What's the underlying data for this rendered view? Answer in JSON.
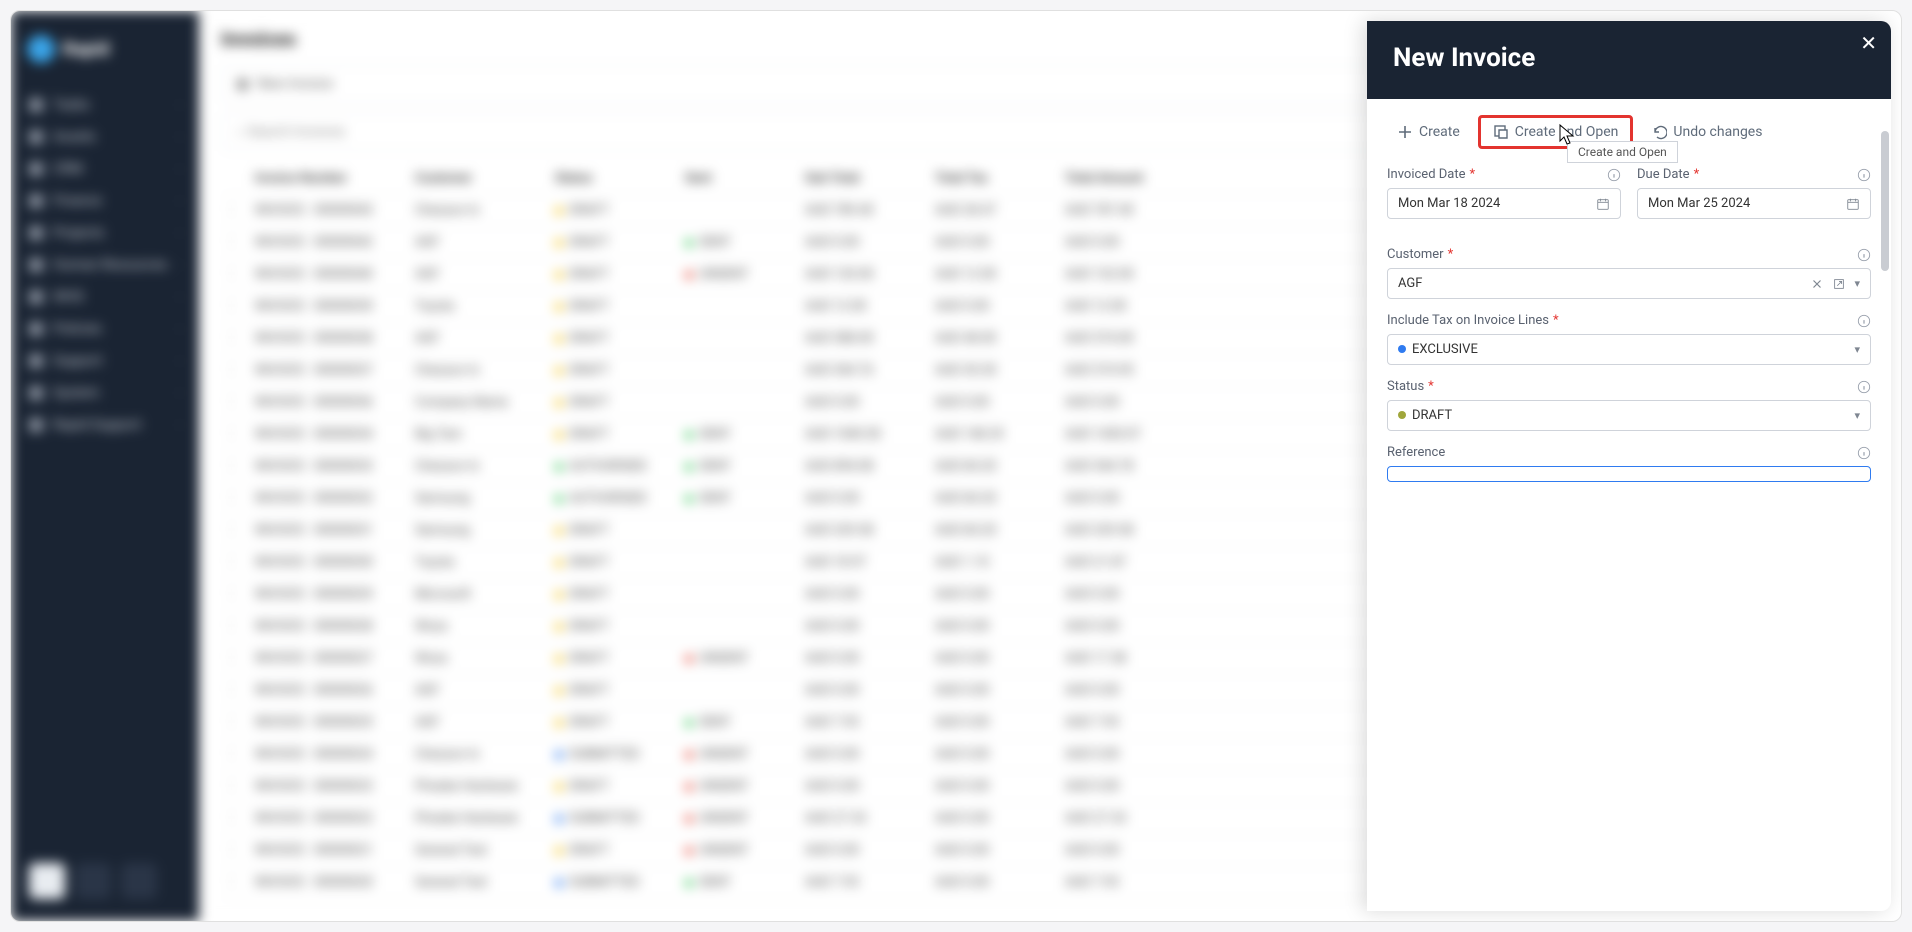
{
  "app": {
    "name": "Rapid"
  },
  "sidebar": {
    "items": [
      {
        "label": "Tasks"
      },
      {
        "label": "Assets"
      },
      {
        "label": "CRM"
      },
      {
        "label": "Finance"
      },
      {
        "label": "Projects"
      },
      {
        "label": "Human Resources"
      },
      {
        "label": "WHS"
      },
      {
        "label": "Policies"
      },
      {
        "label": "Support"
      },
      {
        "label": "System"
      },
      {
        "label": "Rapid Support"
      }
    ]
  },
  "page": {
    "title": "Invoices",
    "new_label": "New Invoice",
    "search_placeholder": "Search Invoices"
  },
  "table": {
    "headers": [
      "",
      "Invoice Number",
      "Customer",
      "Status",
      "Sent",
      "Sub Total",
      "Total Tax",
      "Total Amount"
    ],
    "rows": [
      {
        "num": "INVOICE - 00000043",
        "cust": "Chesson In",
        "status": "DRAFT",
        "sd": "y",
        "sent": "",
        "sub": "AUD 789.40",
        "tax": "AUD 28.47",
        "tot": "AUD 787.40"
      },
      {
        "num": "INVOICE - 00000042",
        "cust": "AGF",
        "status": "DRAFT",
        "sd": "y",
        "sent": "SENT",
        "sub": "AUD 0.00",
        "tax": "AUD 0.00",
        "tot": "AUD 0.00",
        "sentd": "g"
      },
      {
        "num": "INVOICE - 00000040",
        "cust": "AGF",
        "status": "DRAFT",
        "sd": "y",
        "sent": "UNSENT",
        "sub": "AUD 120.00",
        "tax": "AUD 12.00",
        "tot": "AUD 132.00",
        "sentd": "r"
      },
      {
        "num": "INVOICE - 00000039",
        "cust": "Toyota",
        "status": "DRAFT",
        "sd": "y",
        "sent": "",
        "sub": "AUD 12.00",
        "tax": "AUD 0.00",
        "tot": "AUD 12.00"
      },
      {
        "num": "INVOICE - 00000038",
        "cust": "AGF",
        "status": "DRAFT",
        "sd": "y",
        "sent": "",
        "sub": "AUD 588.00",
        "tax": "AUD 48.00",
        "tot": "AUD 574.00"
      },
      {
        "num": "INVOICE - 00000037",
        "cust": "Chesson In",
        "status": "DRAFT",
        "sd": "y",
        "sent": "",
        "sub": "AUD 304.76",
        "tax": "AUD 30.30",
        "tot": "AUD 374.95"
      },
      {
        "num": "INVOICE - 00000036",
        "cust": "Company Name",
        "status": "DRAFT",
        "sd": "y",
        "sent": "",
        "sub": "AUD 0.00",
        "tax": "AUD 0.00",
        "tot": "AUD 0.00"
      },
      {
        "num": "INVOICE - 00000034",
        "cust": "Big Tam",
        "status": "DRAFT",
        "sd": "y",
        "sent": "SENT",
        "sub": "AUD 1040.50",
        "tax": "AUD 148.29",
        "tot": "AUD 1430.07",
        "sentd": "g"
      },
      {
        "num": "INVOICE - 00000033",
        "cust": "Chesson In",
        "status": "AUTHORISED",
        "sd": "g",
        "sent": "SENT",
        "sub": "AUD 894.08",
        "tax": "AUD 84.20",
        "tot": "AUD 544.78",
        "sentd": "g"
      },
      {
        "num": "INVOICE - 00000032",
        "cust": "Samsung",
        "status": "AUTHORISED",
        "sd": "g",
        "sent": "SENT",
        "sub": "AUD 0.00",
        "tax": "AUD 84.20",
        "tot": "AUD 0.00",
        "sentd": "g"
      },
      {
        "num": "INVOICE - 00000031",
        "cust": "Samsung",
        "status": "DRAFT",
        "sd": "y",
        "sent": "",
        "sub": "AUD 329.58",
        "tax": "AUD 84.20",
        "tot": "AUD 329.58"
      },
      {
        "num": "INVOICE - 00000030",
        "cust": "Toyota",
        "status": "DRAFT",
        "sd": "y",
        "sent": "",
        "sub": "AUD 18.97",
        "tax": "AUD 1.10",
        "tot": "AUD 21.87"
      },
      {
        "num": "INVOICE - 00000029",
        "cust": "Microsoft",
        "status": "DRAFT",
        "sd": "y",
        "sent": "",
        "sub": "AUD 0.00",
        "tax": "AUD 0.00",
        "tot": "AUD 0.00"
      },
      {
        "num": "INVOICE - 00000028",
        "cust": "Woza",
        "status": "DRAFT",
        "sd": "y",
        "sent": "",
        "sub": "AUD 0.00",
        "tax": "AUD 0.00",
        "tot": "AUD 0.00"
      },
      {
        "num": "INVOICE - 00000027",
        "cust": "Woza",
        "status": "DRAFT",
        "sd": "y",
        "sent": "UNSENT",
        "sub": "AUD 0.00",
        "tax": "AUD 0.00",
        "tot": "AUD 17.38",
        "sentd": "r"
      },
      {
        "num": "INVOICE - 00000026",
        "cust": "AGF",
        "status": "DRAFT",
        "sd": "y",
        "sent": "",
        "sub": "AUD 0.00",
        "tax": "AUD 0.00",
        "tot": "AUD 0.00"
      },
      {
        "num": "INVOICE - 00000025",
        "cust": "AGF",
        "status": "DRAFT",
        "sd": "y",
        "sent": "SENT",
        "sub": "AUD 7.93",
        "tax": "AUD 0.00",
        "tot": "AUD 7.93",
        "sentd": "g"
      },
      {
        "num": "INVOICE - 00000024",
        "cust": "Chesson In",
        "status": "SUBMITTED",
        "sd": "b",
        "sent": "UNSENT",
        "sub": "AUD 0.00",
        "tax": "AUD 0.00",
        "tot": "AUD 0.00",
        "sentd": "r"
      },
      {
        "num": "INVOICE - 00000023",
        "cust": "Phoebe Hardware",
        "status": "DRAFT",
        "sd": "y",
        "sent": "UNSENT",
        "sub": "AUD 0.00",
        "tax": "AUD 0.00",
        "tot": "AUD 0.00",
        "sentd": "r"
      },
      {
        "num": "INVOICE - 00000022",
        "cust": "Phoebe Hardware",
        "status": "SUBMITTED",
        "sd": "b",
        "sent": "UNSENT",
        "sub": "AUD 27.33",
        "tax": "AUD 0.00",
        "tot": "AUD 27.33",
        "sentd": "r"
      },
      {
        "num": "INVOICE - 00000021",
        "cust": "General Test",
        "status": "DRAFT",
        "sd": "y",
        "sent": "UNSENT",
        "sub": "AUD 0.00",
        "tax": "AUD 0.00",
        "tot": "AUD 0.00",
        "sentd": "r"
      },
      {
        "num": "INVOICE - 00000020",
        "cust": "General Test",
        "status": "SUBMITTED",
        "sd": "b",
        "sent": "SENT",
        "sub": "AUD 7.93",
        "tax": "AUD 0.00",
        "tot": "AUD 7.93",
        "sentd": "g"
      }
    ]
  },
  "panel": {
    "title": "New Invoice",
    "actions": {
      "create": "Create",
      "create_open": "Create and Open",
      "undo": "Undo changes"
    },
    "tooltip": "Create and Open",
    "fields": {
      "invoiced_date": {
        "label": "Invoiced Date",
        "value": "Mon Mar 18 2024"
      },
      "due_date": {
        "label": "Due Date",
        "value": "Mon Mar 25 2024"
      },
      "customer": {
        "label": "Customer",
        "value": "AGF"
      },
      "tax": {
        "label": "Include Tax on Invoice Lines",
        "value": "EXCLUSIVE"
      },
      "status": {
        "label": "Status",
        "value": "DRAFT"
      },
      "reference": {
        "label": "Reference",
        "value": ""
      }
    }
  }
}
